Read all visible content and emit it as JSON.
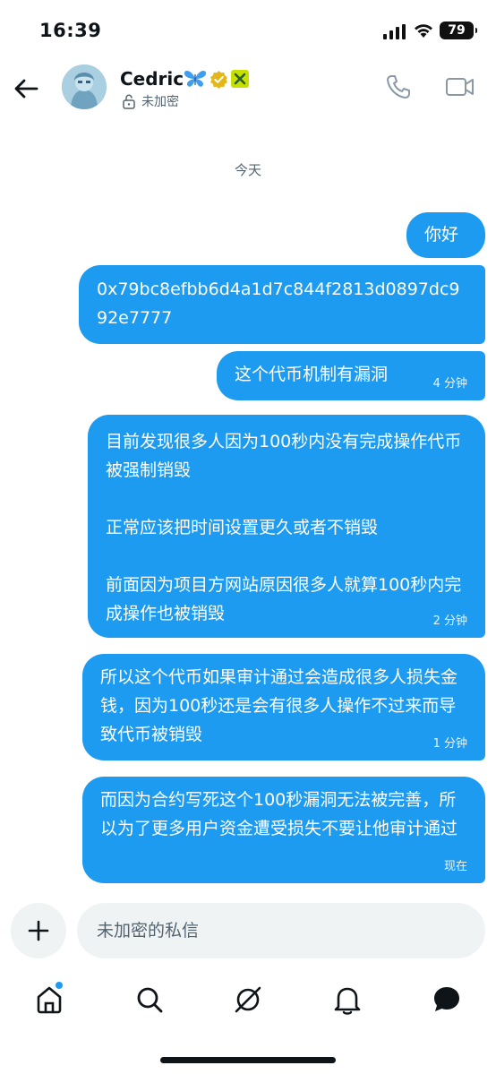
{
  "status": {
    "time": "16:39",
    "battery": "79"
  },
  "header": {
    "name": "Cedric",
    "encryption": "未加密"
  },
  "chat": {
    "date": "今天",
    "messages": [
      {
        "text": "你好",
        "time": ""
      },
      {
        "text": "0x79bc8efbb6d4a1d7c844f2813d0897dc992e7777",
        "time": ""
      },
      {
        "text": "这个代币机制有漏洞",
        "time": "4 分钟"
      },
      {
        "text": "目前发现很多人因为100秒内没有完成操作代币被强制销毁\n\n正常应该把时间设置更久或者不销毁\n\n前面因为项目方网站原因很多人就算100秒内完成操作也被销毁",
        "time": "2 分钟"
      },
      {
        "text": "所以这个代币如果审计通过会造成很多人损失金钱，因为100秒还是会有很多人操作不过来而导致代币被销毁",
        "time": "1 分钟"
      },
      {
        "text": "而因为合约写死这个100秒漏洞无法被完善，所以为了更多用户资金遭受损失不要让他审计通过",
        "time": "现在"
      }
    ]
  },
  "composer": {
    "placeholder": "未加密的私信"
  },
  "nav": {
    "icons": [
      "home-icon",
      "search-icon",
      "grok-icon",
      "bell-icon",
      "messages-icon"
    ]
  },
  "colors": {
    "accent": "#1d9bf0",
    "bubble_text": "#ffffff",
    "muted": "#536471"
  }
}
